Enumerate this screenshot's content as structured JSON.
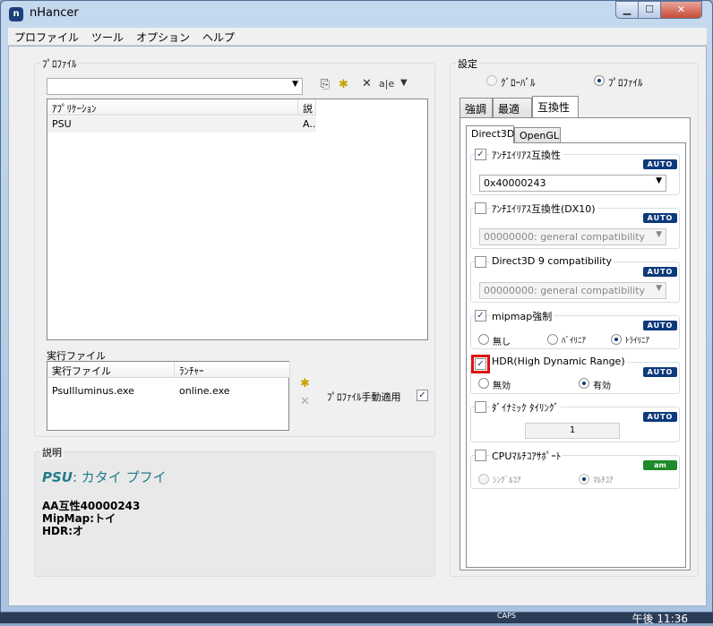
{
  "window": {
    "title": "nHancer",
    "app_icon": "n",
    "min": "▁",
    "max": "☐",
    "close": "✕"
  },
  "menu": [
    "プロファイル",
    "ツール",
    "オプション",
    "ヘルプ"
  ],
  "profile_group": {
    "legend": "ﾌﾟﾛﾌｧｲﾙ",
    "combo_value": "",
    "toolbar": {
      "copy": "⎘",
      "new": "✱",
      "delete": "✕",
      "rename": "a|e",
      "filter": "▼"
    },
    "columns": [
      "ｱﾌﾟﾘｹｰｼｮﾝ",
      "説"
    ],
    "rows": [
      {
        "app": "PSU",
        "desc": "A.."
      }
    ]
  },
  "exec_group": {
    "legend": "実行ファイル",
    "columns": [
      "実行ファイル",
      "ﾗﾝﾁｬｰ"
    ],
    "rows": [
      {
        "file": "PsuIlluminus.exe",
        "launcher": "online.exe"
      }
    ],
    "auto_apply_label": "ﾌﾟﾛﾌｧｲﾙ手動適用",
    "auto_apply_checked": "✓",
    "add_icon": "✱",
    "remove_icon": "✕"
  },
  "description": {
    "legend": "説明",
    "heading_game": "PSU",
    "heading_rest": ": カタイ プフイ",
    "lines": [
      "AA互性40000243",
      "MipMap:トイ",
      "HDR:オ"
    ]
  },
  "settings": {
    "legend": "設定",
    "global_label": "ｸﾞﾛｰﾊﾞﾙ",
    "profile_label": "ﾌﾟﾛﾌｧｲﾙ",
    "tabs": [
      "強調",
      "最適化",
      "互換性"
    ],
    "subtabs": [
      "Direct3D",
      "OpenGL"
    ],
    "auto": "AUTO",
    "am": "am",
    "items": {
      "aa_compat": {
        "label": "ｱﾝﾁｴｲﾘｱｽ互換性",
        "value": "0x40000243",
        "checked": "✓"
      },
      "aa_dx10": {
        "label": "ｱﾝﾁｴｲﾘｱｽ互換性(DX10)",
        "value": "00000000: general compatibility"
      },
      "d3d9": {
        "label": "Direct3D 9 compatibility",
        "value": "00000000: general compatibility"
      },
      "mipmap": {
        "label": "mipmap強制",
        "checked": "✓",
        "opt_none": "無し",
        "opt_bilinear": "ﾊﾞｲﾘﾆｱ",
        "opt_trilinear": "ﾄﾗｲﾘﾆｱ"
      },
      "hdr": {
        "label": "HDR(High Dynamic Range)",
        "checked": "✓",
        "opt_off": "無効",
        "opt_on": "有効"
      },
      "tiling": {
        "label": "ﾀﾞｲﾅﾐｯｸ ﾀｲﾘﾝｸﾞ",
        "value": "1"
      },
      "cpu": {
        "label": "CPUﾏﾙﾁｺｱｻﾎﾟｰﾄ",
        "opt_single": "ｼﾝｸﾞﾙｺｱ",
        "opt_multi": "ﾏﾙﾁｺｱ"
      }
    }
  },
  "taskbar": {
    "caps": "CAPS",
    "clock": "午後 11:36"
  }
}
